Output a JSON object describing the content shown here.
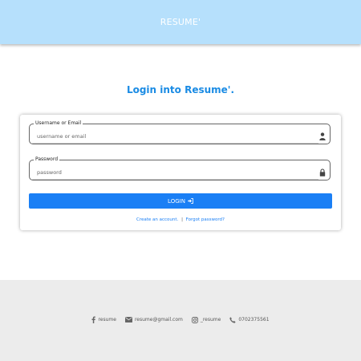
{
  "header": {
    "brand": "RESUME'"
  },
  "page": {
    "title": "Login into Resume'."
  },
  "form": {
    "username": {
      "label": "Username or Email",
      "placeholder": "username or email",
      "icon": "user-icon"
    },
    "password": {
      "label": "Password",
      "placeholder": "password",
      "icon": "lock-icon"
    },
    "login_label": "LOGIN",
    "login_icon": "sign-in-icon",
    "create_account": "Create an account.",
    "separator": "|",
    "forgot_password": "Forgot password?"
  },
  "footer": {
    "facebook": "resume",
    "email": "resume@gmail.com",
    "instagram": "_resume",
    "phone": "0702375561"
  },
  "colors": {
    "header_bg": "#b6e0fc",
    "accent": "#1a7ff5",
    "title": "#1a8be4",
    "footer_bg": "#ececec"
  }
}
